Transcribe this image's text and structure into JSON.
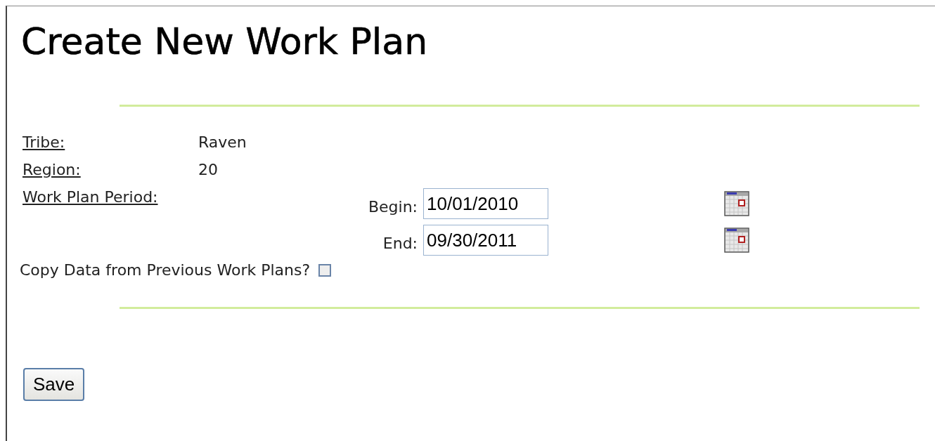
{
  "title": "Create New Work Plan",
  "fields": [
    {
      "label": "Tribe:",
      "value": "Raven"
    },
    {
      "label": "Region:",
      "value": "20"
    }
  ],
  "period": {
    "label": "Work Plan Period:",
    "begin": {
      "label": "Begin:",
      "value": "10/01/2010"
    },
    "end": {
      "label": "End:",
      "value": "09/30/2011"
    }
  },
  "copy": {
    "label": "Copy Data from Previous Work Plans?",
    "checked": false
  },
  "save_button": "Save"
}
